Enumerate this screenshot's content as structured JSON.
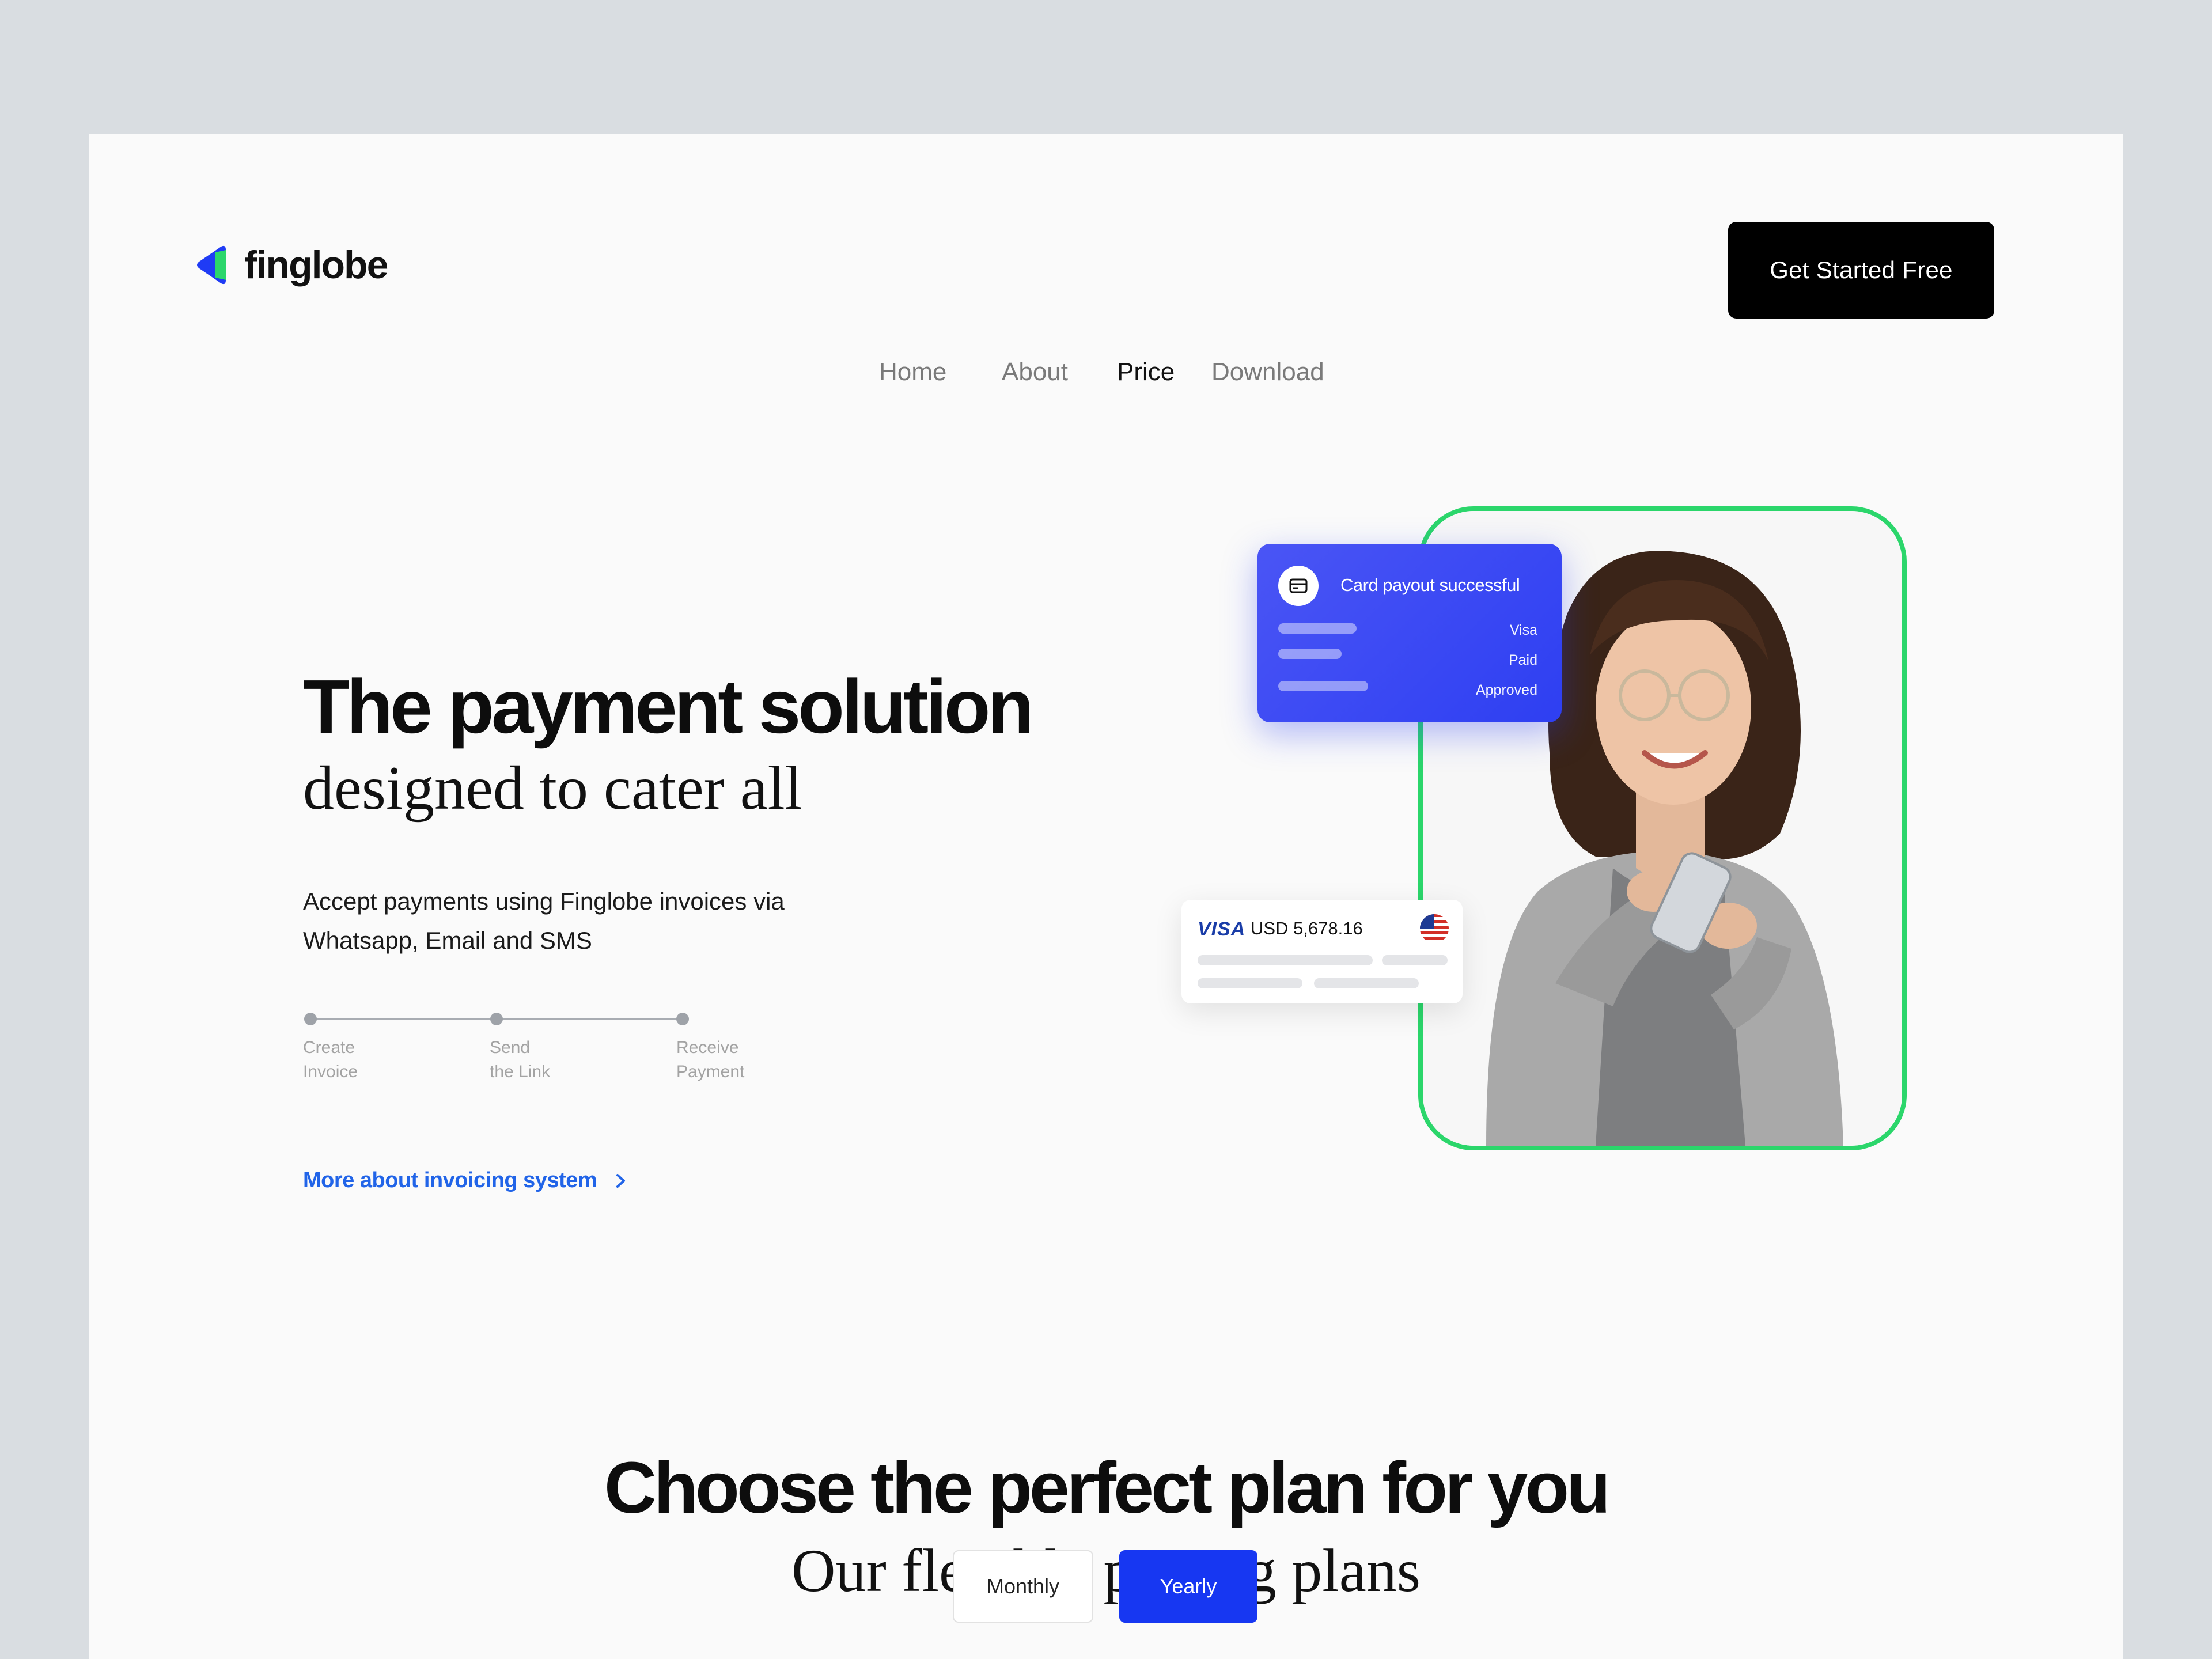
{
  "brand": {
    "name": "finglobe",
    "colors": {
      "green": "#2bd66b",
      "blue": "#1737f2",
      "link": "#2164e8"
    }
  },
  "nav": {
    "items": [
      {
        "label": "Home",
        "active": false
      },
      {
        "label": "About",
        "active": false
      },
      {
        "label": "Price",
        "active": true
      },
      {
        "label": "Download",
        "active": false
      }
    ],
    "cta_label": "Get Started Free"
  },
  "hero": {
    "title": "The payment solution",
    "subtitle": "designed to cater all",
    "description": "Accept payments using Finglobe invoices via Whatsapp, Email and SMS",
    "steps": [
      "Create\nInvoice",
      "Send\nthe Link",
      "Receive\nPayment"
    ],
    "more_link": "More about invoicing system"
  },
  "payout_card": {
    "title": "Card payout successful",
    "statuses": [
      "Visa",
      "Paid",
      "Approved"
    ],
    "icon": "credit-card-icon"
  },
  "visa_card": {
    "brand": "VISA",
    "amount": "USD  5,678.16",
    "flag_icon": "us-flag-icon"
  },
  "pricing": {
    "title": "Choose the perfect plan for you",
    "subtitle": "Our flexible pricing plans",
    "toggle": {
      "monthly": "Monthly",
      "yearly": "Yearly",
      "selected": "Yearly"
    }
  }
}
